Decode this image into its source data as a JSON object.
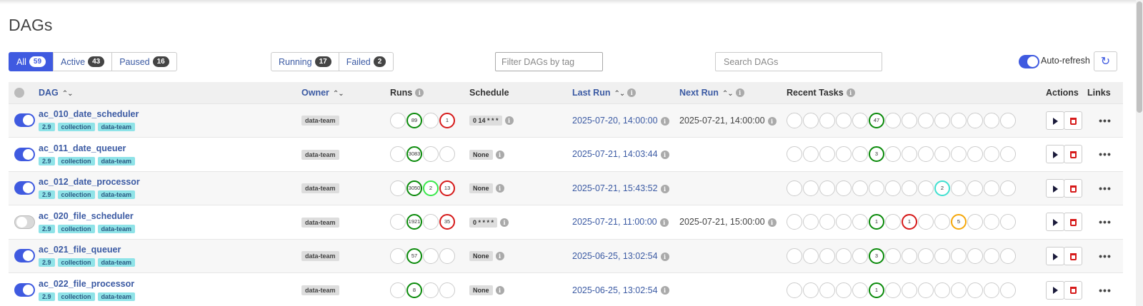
{
  "page_title": "DAGs",
  "status_filters": [
    {
      "label": "All",
      "count": "59",
      "active": true
    },
    {
      "label": "Active",
      "count": "43",
      "active": false
    },
    {
      "label": "Paused",
      "count": "16",
      "active": false
    }
  ],
  "run_filters": [
    {
      "label": "Running",
      "count": "17"
    },
    {
      "label": "Failed",
      "count": "2"
    }
  ],
  "tag_filter_placeholder": "Filter DAGs by tag",
  "search_placeholder": "Search DAGs",
  "auto_refresh_label": "Auto-refresh",
  "auto_refresh_on": true,
  "columns": {
    "dag": "DAG",
    "owner": "Owner",
    "runs": "Runs",
    "schedule": "Schedule",
    "last_run": "Last Run",
    "next_run": "Next Run",
    "recent_tasks": "Recent Tasks",
    "actions": "Actions",
    "links": "Links"
  },
  "colors": {
    "accent": "#3f5ae0",
    "success": "#0a8a0a",
    "failed": "#d61a1a",
    "running": "#39e84b",
    "queued": "#40e0d0",
    "up_for_retry": "#f5a70a",
    "tag_bg": "#8fe3e8"
  },
  "rows": [
    {
      "dag_id": "ac_010_date_scheduler",
      "enabled": true,
      "tags": [
        "2.9",
        "collection",
        "data-team"
      ],
      "owner": "data-team",
      "runs": [
        {
          "state": "empty",
          "label": ""
        },
        {
          "state": "green",
          "label": "89"
        },
        {
          "state": "empty",
          "label": ""
        },
        {
          "state": "red",
          "label": "1"
        }
      ],
      "schedule": "0 14 * * *",
      "last_run": "2025-07-20, 14:00:00",
      "next_run": "2025-07-21, 14:00:00",
      "tasks": [
        {
          "state": "empty",
          "label": ""
        },
        {
          "state": "empty",
          "label": ""
        },
        {
          "state": "empty",
          "label": ""
        },
        {
          "state": "empty",
          "label": ""
        },
        {
          "state": "empty",
          "label": ""
        },
        {
          "state": "green",
          "label": "47"
        },
        {
          "state": "empty",
          "label": ""
        },
        {
          "state": "empty",
          "label": ""
        },
        {
          "state": "empty",
          "label": ""
        },
        {
          "state": "empty",
          "label": ""
        },
        {
          "state": "empty",
          "label": ""
        },
        {
          "state": "empty",
          "label": ""
        },
        {
          "state": "empty",
          "label": ""
        },
        {
          "state": "empty",
          "label": ""
        }
      ]
    },
    {
      "dag_id": "ac_011_date_queuer",
      "enabled": true,
      "tags": [
        "2.9",
        "collection",
        "data-team"
      ],
      "owner": "data-team",
      "runs": [
        {
          "state": "empty",
          "label": ""
        },
        {
          "state": "green",
          "label": "3083"
        },
        {
          "state": "empty",
          "label": ""
        },
        {
          "state": "empty",
          "label": ""
        }
      ],
      "schedule": "None",
      "last_run": "2025-07-21, 14:03:44",
      "next_run": "",
      "tasks": [
        {
          "state": "empty",
          "label": ""
        },
        {
          "state": "empty",
          "label": ""
        },
        {
          "state": "empty",
          "label": ""
        },
        {
          "state": "empty",
          "label": ""
        },
        {
          "state": "empty",
          "label": ""
        },
        {
          "state": "green",
          "label": "3"
        },
        {
          "state": "empty",
          "label": ""
        },
        {
          "state": "empty",
          "label": ""
        },
        {
          "state": "empty",
          "label": ""
        },
        {
          "state": "empty",
          "label": ""
        },
        {
          "state": "empty",
          "label": ""
        },
        {
          "state": "empty",
          "label": ""
        },
        {
          "state": "empty",
          "label": ""
        },
        {
          "state": "empty",
          "label": ""
        }
      ]
    },
    {
      "dag_id": "ac_012_date_processor",
      "enabled": true,
      "tags": [
        "2.9",
        "collection",
        "data-team"
      ],
      "owner": "data-team",
      "runs": [
        {
          "state": "empty",
          "label": ""
        },
        {
          "state": "green",
          "label": "3050"
        },
        {
          "state": "lime",
          "label": "2"
        },
        {
          "state": "red",
          "label": "13"
        }
      ],
      "schedule": "None",
      "last_run": "2025-07-21, 15:43:52",
      "next_run": "",
      "tasks": [
        {
          "state": "empty",
          "label": ""
        },
        {
          "state": "empty",
          "label": ""
        },
        {
          "state": "empty",
          "label": ""
        },
        {
          "state": "empty",
          "label": ""
        },
        {
          "state": "empty",
          "label": ""
        },
        {
          "state": "empty",
          "label": ""
        },
        {
          "state": "empty",
          "label": ""
        },
        {
          "state": "empty",
          "label": ""
        },
        {
          "state": "empty",
          "label": ""
        },
        {
          "state": "cyan",
          "label": "2"
        },
        {
          "state": "empty",
          "label": ""
        },
        {
          "state": "empty",
          "label": ""
        },
        {
          "state": "empty",
          "label": ""
        },
        {
          "state": "empty",
          "label": ""
        }
      ]
    },
    {
      "dag_id": "ac_020_file_scheduler",
      "enabled": false,
      "tags": [
        "2.9",
        "collection",
        "data-team"
      ],
      "owner": "data-team",
      "runs": [
        {
          "state": "empty",
          "label": ""
        },
        {
          "state": "green",
          "label": "1921"
        },
        {
          "state": "empty",
          "label": ""
        },
        {
          "state": "red",
          "label": "35"
        }
      ],
      "schedule": "0 * * * *",
      "last_run": "2025-07-21, 11:00:00",
      "next_run": "2025-07-21, 15:00:00",
      "tasks": [
        {
          "state": "empty",
          "label": ""
        },
        {
          "state": "empty",
          "label": ""
        },
        {
          "state": "empty",
          "label": ""
        },
        {
          "state": "empty",
          "label": ""
        },
        {
          "state": "empty",
          "label": ""
        },
        {
          "state": "green",
          "label": "1"
        },
        {
          "state": "empty",
          "label": ""
        },
        {
          "state": "red",
          "label": "1"
        },
        {
          "state": "empty",
          "label": ""
        },
        {
          "state": "empty",
          "label": ""
        },
        {
          "state": "orange",
          "label": "5"
        },
        {
          "state": "empty",
          "label": ""
        },
        {
          "state": "empty",
          "label": ""
        },
        {
          "state": "empty",
          "label": ""
        }
      ]
    },
    {
      "dag_id": "ac_021_file_queuer",
      "enabled": true,
      "tags": [
        "2.9",
        "collection",
        "data-team"
      ],
      "owner": "data-team",
      "runs": [
        {
          "state": "empty",
          "label": ""
        },
        {
          "state": "green",
          "label": "57"
        },
        {
          "state": "empty",
          "label": ""
        },
        {
          "state": "empty",
          "label": ""
        }
      ],
      "schedule": "None",
      "last_run": "2025-06-25, 13:02:54",
      "next_run": "",
      "tasks": [
        {
          "state": "empty",
          "label": ""
        },
        {
          "state": "empty",
          "label": ""
        },
        {
          "state": "empty",
          "label": ""
        },
        {
          "state": "empty",
          "label": ""
        },
        {
          "state": "empty",
          "label": ""
        },
        {
          "state": "green",
          "label": "3"
        },
        {
          "state": "empty",
          "label": ""
        },
        {
          "state": "empty",
          "label": ""
        },
        {
          "state": "empty",
          "label": ""
        },
        {
          "state": "empty",
          "label": ""
        },
        {
          "state": "empty",
          "label": ""
        },
        {
          "state": "empty",
          "label": ""
        },
        {
          "state": "empty",
          "label": ""
        },
        {
          "state": "empty",
          "label": ""
        }
      ]
    },
    {
      "dag_id": "ac_022_file_processor",
      "enabled": true,
      "tags": [
        "2.9",
        "collection",
        "data-team"
      ],
      "owner": "data-team",
      "runs": [
        {
          "state": "empty",
          "label": ""
        },
        {
          "state": "green",
          "label": "8"
        },
        {
          "state": "empty",
          "label": ""
        },
        {
          "state": "empty",
          "label": ""
        }
      ],
      "schedule": "None",
      "last_run": "2025-06-25, 13:02:54",
      "next_run": "",
      "tasks": [
        {
          "state": "empty",
          "label": ""
        },
        {
          "state": "empty",
          "label": ""
        },
        {
          "state": "empty",
          "label": ""
        },
        {
          "state": "empty",
          "label": ""
        },
        {
          "state": "empty",
          "label": ""
        },
        {
          "state": "green",
          "label": "1"
        },
        {
          "state": "empty",
          "label": ""
        },
        {
          "state": "empty",
          "label": ""
        },
        {
          "state": "empty",
          "label": ""
        },
        {
          "state": "empty",
          "label": ""
        },
        {
          "state": "empty",
          "label": ""
        },
        {
          "state": "empty",
          "label": ""
        },
        {
          "state": "empty",
          "label": ""
        },
        {
          "state": "empty",
          "label": ""
        }
      ]
    }
  ]
}
